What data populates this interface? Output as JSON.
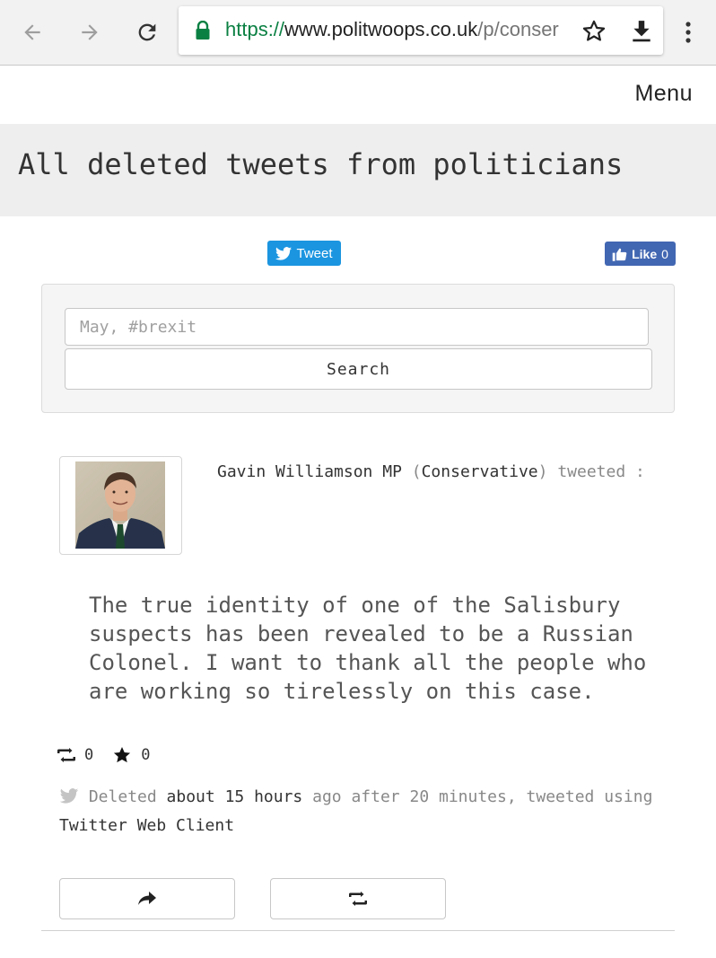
{
  "browser": {
    "url_scheme": "https://",
    "url_host": "www.politwoops.co.uk",
    "url_path": "/p/conser"
  },
  "site": {
    "menu_label": "Menu",
    "page_title": "All deleted tweets from politicians"
  },
  "social": {
    "tweet_label": "Tweet",
    "like_label": "Like",
    "like_count": "0"
  },
  "search": {
    "placeholder": "May, #brexit",
    "button_label": "Search"
  },
  "tweet": {
    "author": "Gavin Williamson MP",
    "party_open": "(",
    "party": "Conservative",
    "party_close": ")",
    "verb": "tweeted",
    "colon": ":",
    "text": "The true identity of one of the Salisbury suspects has been revealed to be a Russian Colonel. I want to thank all the people who are working so tirelessly on this case.",
    "retweets": "0",
    "favorites": "0",
    "meta_deleted": "Deleted",
    "meta_when": "about 15 hours",
    "meta_after": "ago after 20 minutes, tweeted using",
    "meta_client": "Twitter Web Client"
  },
  "colors": {
    "url_green": "#0b8043",
    "tweet_blue": "#1b95e0",
    "facebook_blue": "#4267b2"
  },
  "icons": [
    "back-arrow-icon",
    "forward-arrow-icon",
    "reload-icon",
    "lock-icon",
    "star-bookmark-icon",
    "download-icon",
    "more-vert-icon",
    "twitter-bird-icon",
    "thumbs-up-icon",
    "retweet-icon",
    "star-icon",
    "share-icon"
  ]
}
